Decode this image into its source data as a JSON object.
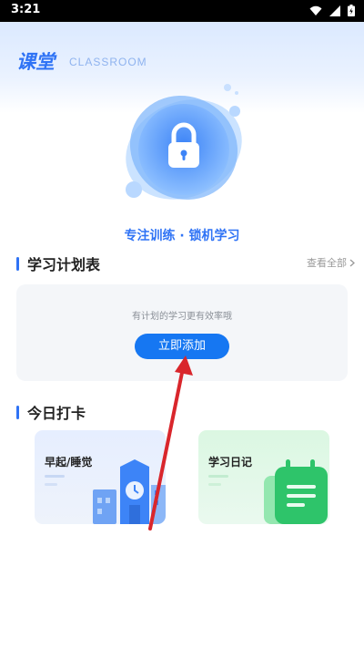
{
  "status_bar": {
    "time": "3:21"
  },
  "header": {
    "title": "课堂",
    "subtitle": "CLASSROOM"
  },
  "hero": {
    "tagline": "专注训练 · 锁机学习",
    "icon": "lock-icon"
  },
  "plan_section": {
    "title": "学习计划表",
    "see_all": "查看全部",
    "empty_hint": "有计划的学习更有效率哦",
    "add_button": "立即添加"
  },
  "checkin_section": {
    "title": "今日打卡",
    "cards": [
      {
        "label": "早起/睡觉",
        "icon": "clock-building-icon"
      },
      {
        "label": "学习日记",
        "icon": "notebook-icon"
      }
    ]
  },
  "colors": {
    "accent": "#2f73f5",
    "button": "#1677f2",
    "annotation_arrow": "#d9262c"
  }
}
